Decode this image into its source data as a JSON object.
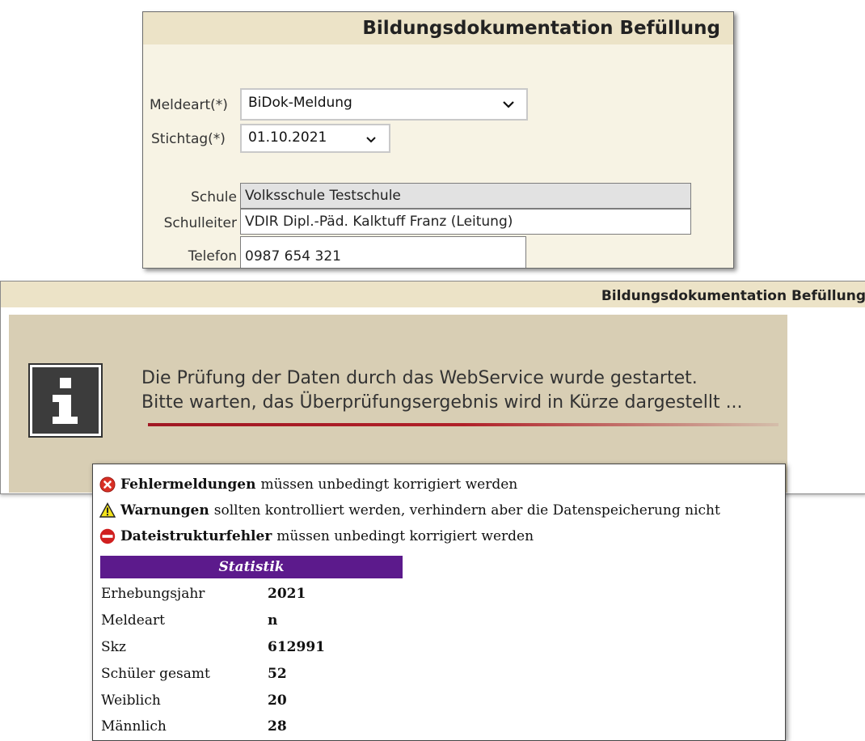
{
  "form": {
    "title": "Bildungsdokumentation Befüllung",
    "meldeart_label": "Meldeart(*)",
    "meldeart_value": "BiDok-Meldung",
    "stichtag_label": "Stichtag(*)",
    "stichtag_value": "01.10.2021",
    "schule_label": "Schule",
    "schule_value": "Volksschule Testschule",
    "schulleiter_label": "Schulleiter",
    "schulleiter_value": "VDIR Dipl.-Päd. Kalktuff Franz (Leitung)",
    "telefon_label": "Telefon",
    "telefon_value": "0987 654 321"
  },
  "info": {
    "title": "Bildungsdokumentation Befüllung",
    "line1": "Die Prüfung der Daten durch das WebService wurde gestartet.",
    "line2": "Bitte warten, das Überprüfungsergebnis wird in Kürze dargestellt ...",
    "icon": "info-icon"
  },
  "legend": [
    {
      "icon": "error-icon",
      "bold": "Fehlermeldungen",
      "text": "müssen unbedingt korrigiert werden",
      "color": "#d93025"
    },
    {
      "icon": "warning-icon",
      "bold": "Warnungen",
      "text": "sollten kontrolliert werden, verhindern aber die Datenspeicherung nicht",
      "color": "#f2e21b"
    },
    {
      "icon": "stop-icon",
      "bold": "Dateistrukturfehler",
      "text": "müssen unbedingt korrigiert werden",
      "color": "#d01f1f"
    }
  ],
  "statistik": {
    "title": "Statistik",
    "rows": [
      {
        "label": "Erhebungsjahr",
        "value": "2021"
      },
      {
        "label": "Meldeart",
        "value": "n"
      },
      {
        "label": "Skz",
        "value": "612991"
      },
      {
        "label": "Schüler gesamt",
        "value": "52"
      },
      {
        "label": "Weiblich",
        "value": "20"
      },
      {
        "label": "Männlich",
        "value": "28"
      }
    ]
  },
  "colors": {
    "accent_purple": "#5c1a8c",
    "header_beige": "#ece3c7",
    "info_bg": "#d8ceb4"
  }
}
